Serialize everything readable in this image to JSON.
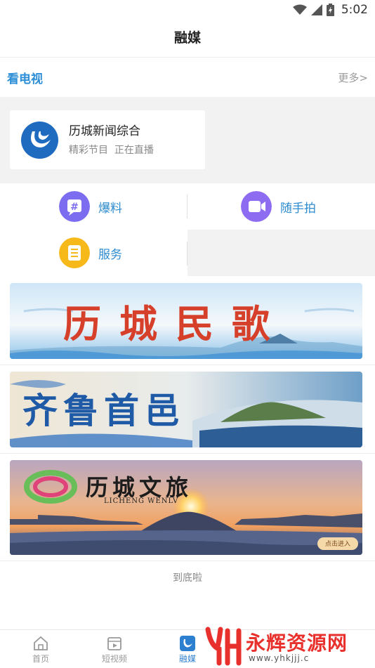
{
  "status_bar": {
    "time": "5:02",
    "icons": [
      "wifi-icon",
      "signal-icon",
      "battery-icon"
    ]
  },
  "header": {
    "title": "融媒"
  },
  "tv_section": {
    "title": "看电视",
    "more": "更多>"
  },
  "channel": {
    "name": "历城新闻综合",
    "program": "精彩节目",
    "status": "正在直播"
  },
  "services": [
    {
      "label": "爆料",
      "icon": "hashtag-icon",
      "color": "#7b6cf0"
    },
    {
      "label": "随手拍",
      "icon": "video-camera-icon",
      "color": "#8e6cf2"
    },
    {
      "label": "服务",
      "icon": "document-icon",
      "color": "#f7b91a"
    }
  ],
  "banners": [
    {
      "title": "历城民歌",
      "subtitle": ""
    },
    {
      "title": "齐鲁首邑",
      "subtitle": ""
    },
    {
      "title": "历城文旅",
      "subtitle": "LICHENG WENLV",
      "button": "点击进入"
    }
  ],
  "footer_text": "到底啦",
  "tabbar": {
    "active": 2,
    "tabs": [
      {
        "label": "首页",
        "icon": "home-icon"
      },
      {
        "label": "短视频",
        "icon": "clapperboard-icon"
      },
      {
        "label": "融媒",
        "icon": "media-logo-icon"
      },
      {
        "label": "",
        "icon": ""
      },
      {
        "label": "",
        "icon": ""
      }
    ]
  },
  "watermark": {
    "text": "永辉资源网",
    "url": "www.yhkjjj.c"
  },
  "colors": {
    "accent_blue": "#2e8fd6",
    "watermark_red": "#e8312d"
  }
}
